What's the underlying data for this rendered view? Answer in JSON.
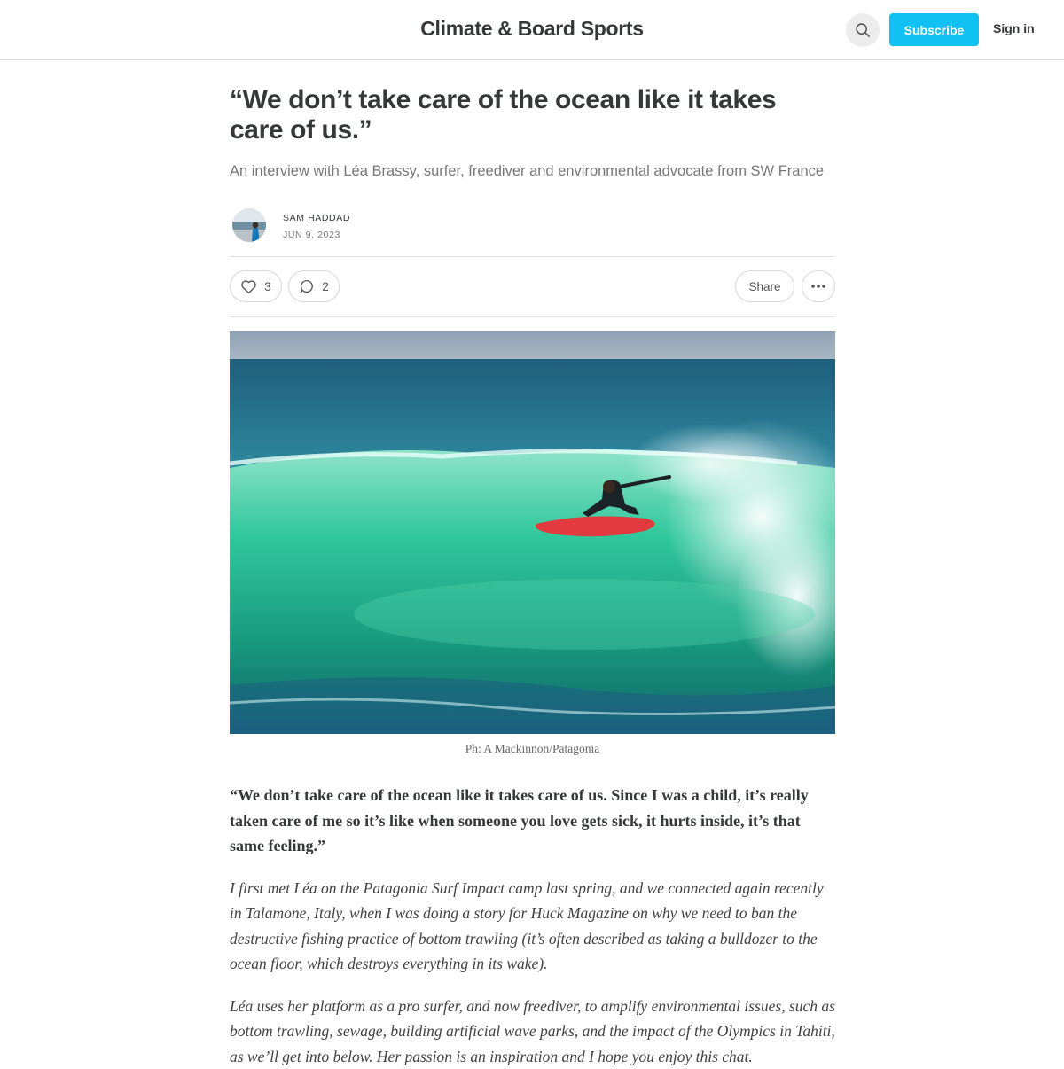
{
  "header": {
    "site_title": "Climate & Board Sports",
    "search_icon": "search-icon",
    "subscribe_label": "Subscribe",
    "signin_label": "Sign in",
    "accent_color": "#12c1f4"
  },
  "article": {
    "headline": "“We don’t take care of the ocean like it takes care of us.”",
    "subtitle": "An interview with Léa Brassy, surfer, freediver and environmental advocate from SW France",
    "author": "SAM HADDAD",
    "date": "JUN 9, 2023",
    "actions": {
      "likes": "3",
      "like_icon": "heart-icon",
      "comments": "2",
      "comment_icon": "comment-icon",
      "share_label": "Share",
      "more_icon": "more-options-icon"
    },
    "hero_caption": "Ph: A Mackinnon/Patagonia",
    "quote": "“We don’t take care of the ocean like it takes care of us. Since I was a child, it’s really taken care of me so it’s like when someone you love gets sick, it hurts inside, it’s that same feeling.”",
    "paragraphs": [
      "I first met Léa on the Patagonia Surf Impact camp last spring, and we connected again recently in Talamone, Italy, when I was doing a story for Huck Magazine on why we need to ban the destructive fishing practice of bottom trawling (it’s often described as taking a bulldozer to the ocean floor, which destroys everything in its wake).",
      "Léa uses her platform as a pro surfer, and now freediver, to amplify environmental issues, such as bottom trawling, sewage, building artificial wave parks, and the impact of the Olympics in Tahiti, as we’ll get into below. Her passion is an inspiration and I hope you enjoy this chat."
    ]
  }
}
